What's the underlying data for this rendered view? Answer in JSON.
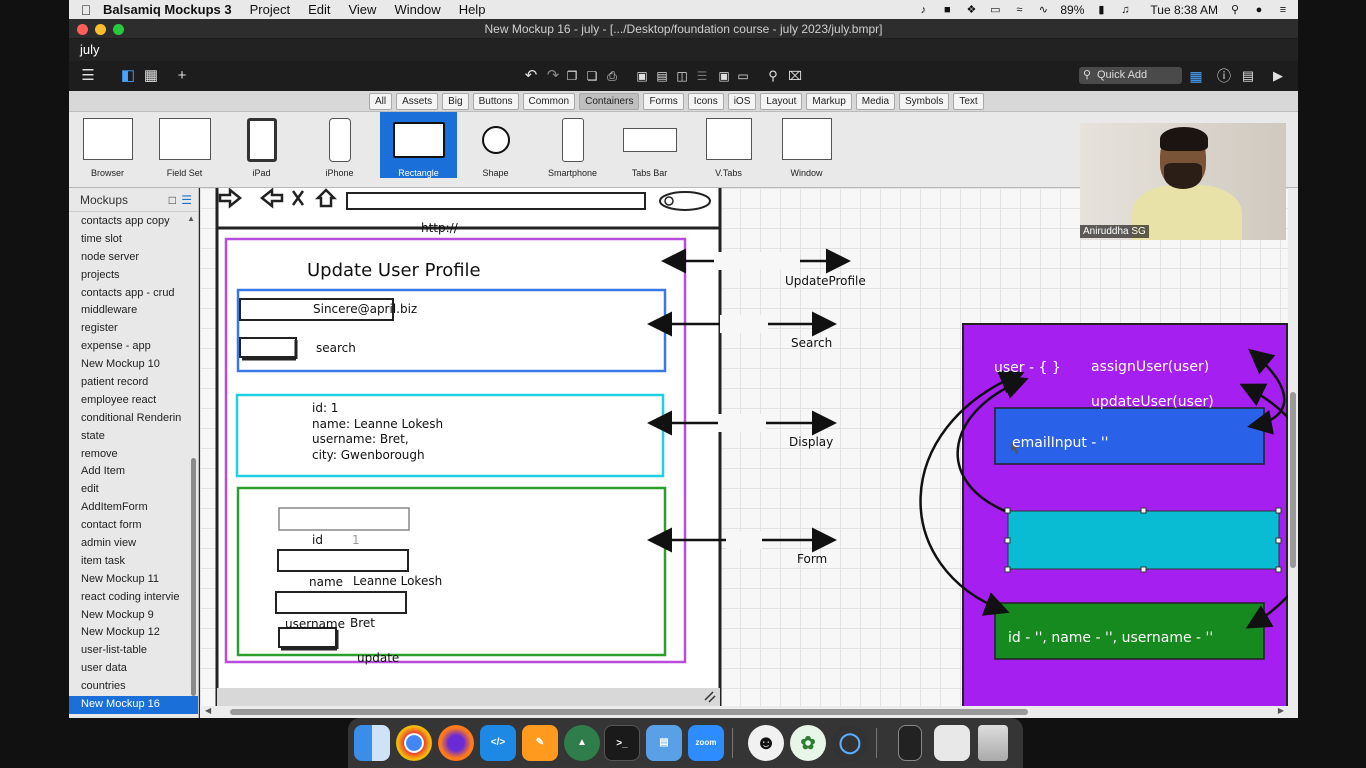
{
  "menubar": {
    "app_name": "Balsamiq Mockups 3",
    "items": [
      "Project",
      "Edit",
      "View",
      "Window",
      "Help"
    ],
    "battery": "89%",
    "clock": "Tue 8:38 AM"
  },
  "window": {
    "title": "New Mockup 16 - july - [.../Desktop/foundation course - july 2023/july.bmpr]",
    "project_tab": "july",
    "quick_add": "Quick Add"
  },
  "filter_tabs": [
    "All",
    "Assets",
    "Big",
    "Buttons",
    "Common",
    "Containers",
    "Forms",
    "Icons",
    "iOS",
    "Layout",
    "Markup",
    "Media",
    "Symbols",
    "Text"
  ],
  "filter_active": "Containers",
  "library": [
    "Browser",
    "Field Set",
    "iPad",
    "iPhone",
    "Rectangle",
    "Shape",
    "Smartphone",
    "Tabs Bar",
    "V.Tabs",
    "Window"
  ],
  "library_active": "Rectangle",
  "sidebar": {
    "title": "Mockups",
    "items": [
      "contacts app copy",
      "time slot",
      "node server",
      "projects",
      "contacts app - crud",
      "middleware",
      "register",
      "expense - app",
      "New Mockup 10",
      "patient record",
      "employee react",
      "conditional Renderin",
      "state",
      "remove",
      "Add Item",
      "edit",
      "AddItemForm",
      "contact form",
      "admin view",
      "item task",
      "New Mockup 11",
      "react coding intervie",
      "New Mockup 9",
      "New Mockup 12",
      "user-list-table",
      "user data",
      "countries",
      "New Mockup 16"
    ],
    "active": "New Mockup 16"
  },
  "mockup": {
    "url": "http://",
    "heading": "Update User Profile",
    "email_value": "Sincere@april.biz",
    "search_button": "search",
    "display_lines": [
      "id: 1",
      "name: Leanne Lokesh",
      "username: Bret,",
      "city: Gwenborough"
    ],
    "form": {
      "id_label": "id",
      "id_value": "1",
      "name_label": "name",
      "name_value": "Leanne Lokesh",
      "username_label": "username",
      "username_value": "Bret",
      "update_button": "update"
    }
  },
  "annotations": {
    "update_profile": "UpdateProfile",
    "search": "Search",
    "display": "Display",
    "form": "Form"
  },
  "state_box": {
    "user": "user - { }",
    "assign": "assignUser(user)",
    "update": "updateUser(user)",
    "email_input": "emailInput - ''",
    "form_state": "id - '', name - '', username - ''",
    "colors": {
      "panel": "#a51ff0",
      "blue": "#2962e8",
      "cyan": "#0abcd3",
      "green": "#168a1f"
    }
  },
  "webcam": {
    "name": "Aniruddha SG"
  },
  "dock": [
    "Finder",
    "Chrome",
    "Firefox",
    "VS Code",
    "Pages",
    "Rocket",
    "Terminal",
    "Preview",
    "zoom",
    "Emoji",
    "MongoDB",
    "QuickTime",
    "Phone",
    "Notes",
    "Trash"
  ]
}
